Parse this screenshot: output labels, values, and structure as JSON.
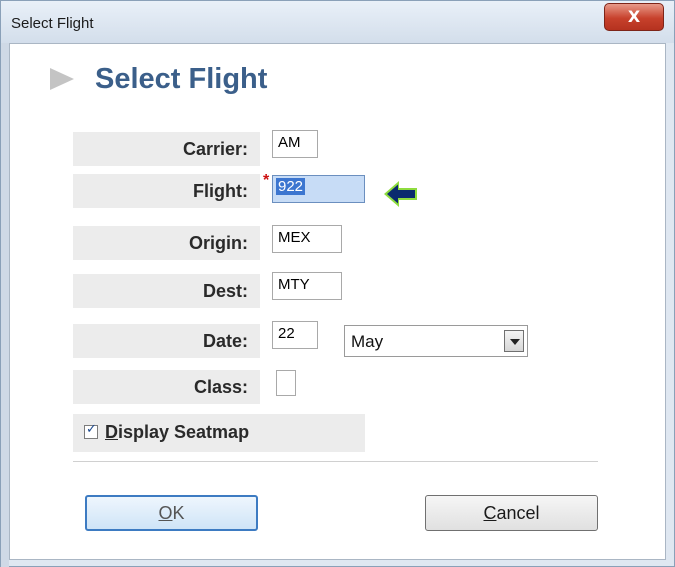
{
  "window": {
    "title": "Select Flight",
    "close_label": "X"
  },
  "header": {
    "title": "Select Flight"
  },
  "form": {
    "carrier": {
      "label": "Carrier:",
      "value": "AM"
    },
    "flight": {
      "label": "Flight:",
      "required_marker": "*",
      "value": "922"
    },
    "origin": {
      "label": "Origin:",
      "value": "MEX"
    },
    "dest": {
      "label": "Dest:",
      "value": "MTY"
    },
    "date": {
      "label": "Date:",
      "day": "22",
      "month": "May"
    },
    "class": {
      "label": "Class:",
      "value": ""
    },
    "display_seatmap": {
      "prefix": "D",
      "rest": "isplay Seatmap",
      "checked": true
    }
  },
  "buttons": {
    "ok": {
      "accel": "O",
      "rest": "K"
    },
    "cancel": {
      "accel": "C",
      "rest": "ancel"
    }
  },
  "icons": {
    "flight_pointer": "left-arrow-icon",
    "header_marker": "chevron-right-icon"
  },
  "colors": {
    "header_title": "#3b5f8a",
    "pointer_fill": "#0b2a6e",
    "pointer_glow": "#8fdc3f",
    "required": "#cc1111"
  }
}
